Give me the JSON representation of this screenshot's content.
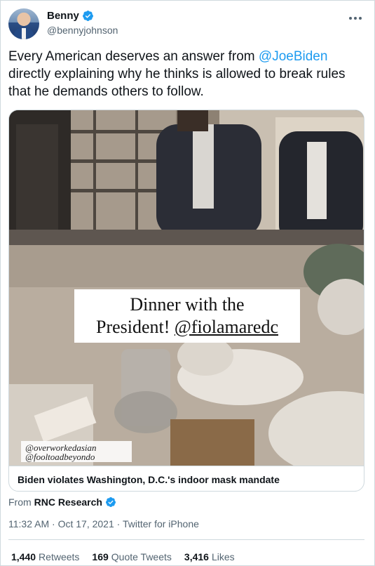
{
  "author": {
    "display_name": "Benny",
    "handle": "@bennyjohnson",
    "verified_icon": "verified-badge-icon"
  },
  "tweet": {
    "text_before": "Every American deserves an answer from ",
    "mention": "@JoeBiden",
    "text_after": " directly explaining why he thinks is allowed to break rules that he demands others to follow."
  },
  "media": {
    "overlay_line1": "Dinner with the",
    "overlay_line2_prefix": "President! ",
    "overlay_line2_handle": "@fiolamaredc",
    "watermark_line1": "@overworkedasian",
    "watermark_line2": "@fooltoadbeyondo",
    "caption": "Biden violates Washington, D.C.'s indoor mask mandate"
  },
  "source": {
    "prefix": "From",
    "name": "RNC Research"
  },
  "meta": {
    "time": "11:32 AM",
    "separator": " · ",
    "date": "Oct 17, 2021",
    "client": "Twitter for iPhone"
  },
  "stats": {
    "retweets_count": "1,440",
    "retweets_label": "Retweets",
    "quotes_count": "169",
    "quotes_label": "Quote Tweets",
    "likes_count": "3,416",
    "likes_label": "Likes"
  },
  "colors": {
    "accent": "#1d9bf0",
    "text_primary": "#0f1419",
    "text_secondary": "#536471",
    "border": "#cfd9de"
  }
}
